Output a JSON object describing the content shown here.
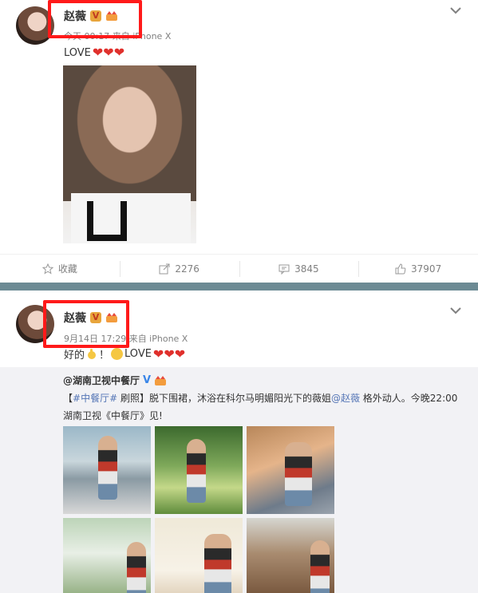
{
  "post1": {
    "user_name": "赵薇",
    "meta": "今天 00:17 来自 iPhone X",
    "text": "LOVE",
    "hearts": "❤❤❤",
    "actions": [
      {
        "label": "收藏",
        "icon": "star-icon"
      },
      {
        "label": "2276",
        "icon": "repost-icon"
      },
      {
        "label": "3845",
        "icon": "comment-icon"
      },
      {
        "label": "37907",
        "icon": "like-icon"
      }
    ]
  },
  "post2": {
    "user_name": "赵薇",
    "meta": "9月14日 17:29 来自 iPhone X",
    "text_prefix": "好的",
    "text_mid": "！",
    "text_love": "LOVE",
    "hearts": "❤❤❤",
    "repost": {
      "user": "@湖南卫视中餐厅",
      "text_parts": {
        "bracket_open": "【",
        "tag": "#中餐厅#",
        "after_tag": " 刷照】脱下围裙，沐浴在科尔马明媚阳光下的薇姐",
        "mention": "@赵薇",
        "after_mention": " 格外动人。今晚22:00湖南卫视《中餐厅》见!"
      }
    }
  },
  "colors": {
    "highlight_red": "#ff1a1a",
    "heart_red": "#e0302c",
    "link_orange": "#eb7350",
    "tag_blue": "#5576b6",
    "divider": "#6c8a94"
  }
}
